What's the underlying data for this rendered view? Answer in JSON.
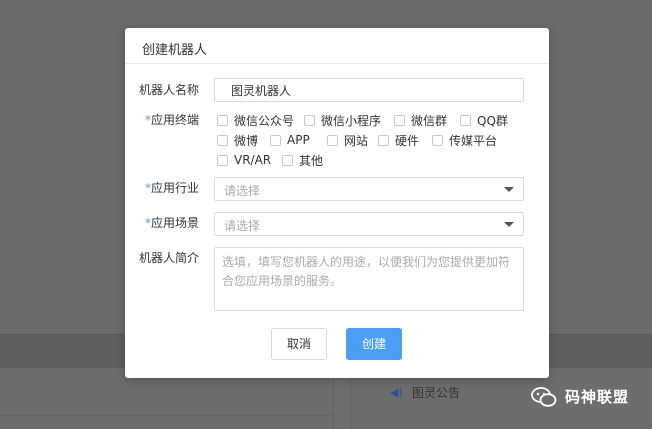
{
  "background": {
    "notice_label": "图灵公告",
    "watermark_text": "码神联盟"
  },
  "dialog": {
    "title": "创建机器人",
    "fields": {
      "name_label": "机器人名称",
      "name_value": "图灵机器人",
      "terminal_label": "应用终端",
      "terminal_options": [
        "微信公众号",
        "微信小程序",
        "微信群",
        "QQ群",
        "微博",
        "APP",
        "网站",
        "硬件",
        "传媒平台",
        "VR/AR",
        "其他"
      ],
      "industry_label": "应用行业",
      "industry_placeholder": "请选择",
      "scene_label": "应用场景",
      "scene_placeholder": "请选择",
      "intro_label": "机器人简介",
      "intro_placeholder": "选填，填写您机器人的用途，以便我们为您提供更加符合您应用场景的服务。"
    },
    "required_mark": "*",
    "buttons": {
      "cancel": "取消",
      "create": "创建"
    }
  },
  "colors": {
    "primary": "#4a9ff5",
    "required": "#5a9bd5",
    "overlay": "#6b6b6b"
  }
}
